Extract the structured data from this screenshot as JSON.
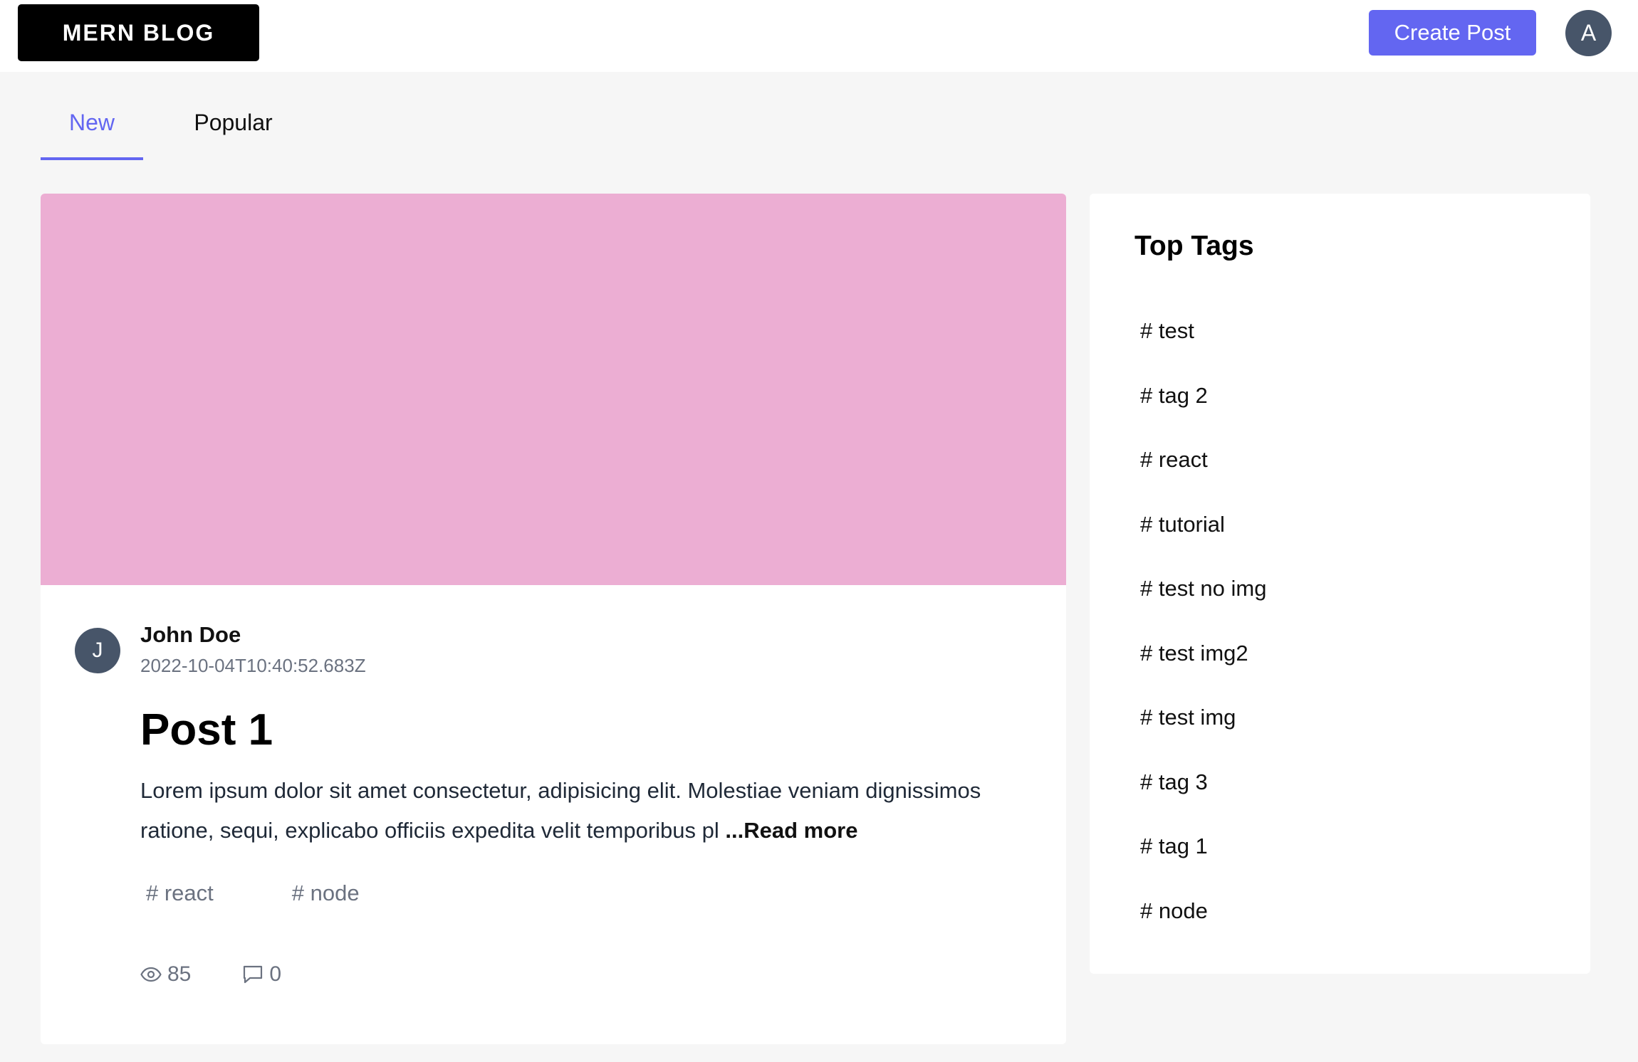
{
  "header": {
    "logo": "MERN BLOG",
    "create_button": "Create Post",
    "user_initial": "A"
  },
  "tabs": [
    {
      "label": "New",
      "active": true
    },
    {
      "label": "Popular",
      "active": false
    }
  ],
  "post": {
    "cover_color": "#ecaed3",
    "author": {
      "initial": "J",
      "name": "John Doe"
    },
    "date": "2022-10-04T10:40:52.683Z",
    "title": "Post 1",
    "excerpt": "Lorem ipsum dolor sit amet consectetur, adipisicing elit. Molestiae veniam dignissimos ratione, sequi, explicabo officiis expedita velit temporibus pl ",
    "read_more": "...Read more",
    "tags": [
      "# react",
      "# node"
    ],
    "views": "85",
    "comments": "0"
  },
  "sidebar": {
    "title": "Top Tags",
    "tags": [
      "# test",
      "# tag 2",
      "# react",
      "# tutorial",
      "# test no img",
      "# test img2",
      "# test img",
      "# tag 3",
      "# tag 1",
      "# node"
    ]
  },
  "colors": {
    "accent": "#6366f1",
    "avatar": "#475569",
    "muted_text": "#6b7280"
  }
}
